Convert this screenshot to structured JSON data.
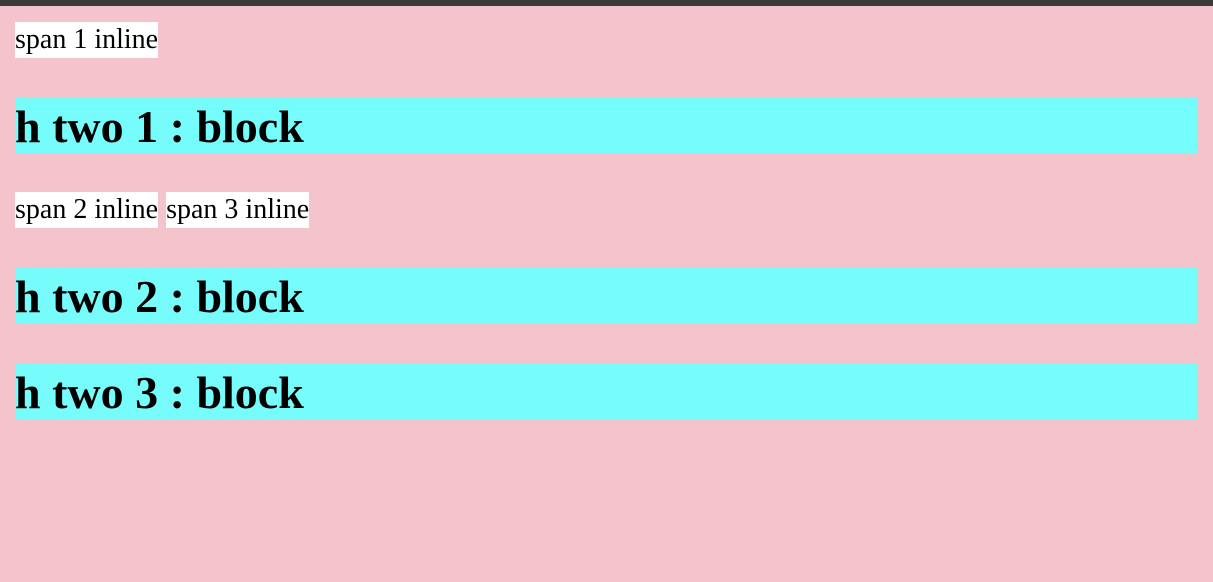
{
  "colors": {
    "page_background": "#f4c3cc",
    "span_background": "#ffffff",
    "heading_background": "#77fcfc",
    "top_bar": "#3b3b3b"
  },
  "span1": "span 1 inline",
  "h2_1": "h two 1 : block",
  "span2": "span 2 inline",
  "span3": "span 3 inline",
  "h2_2": "h two 2 : block",
  "h2_3": "h two 3 : block"
}
